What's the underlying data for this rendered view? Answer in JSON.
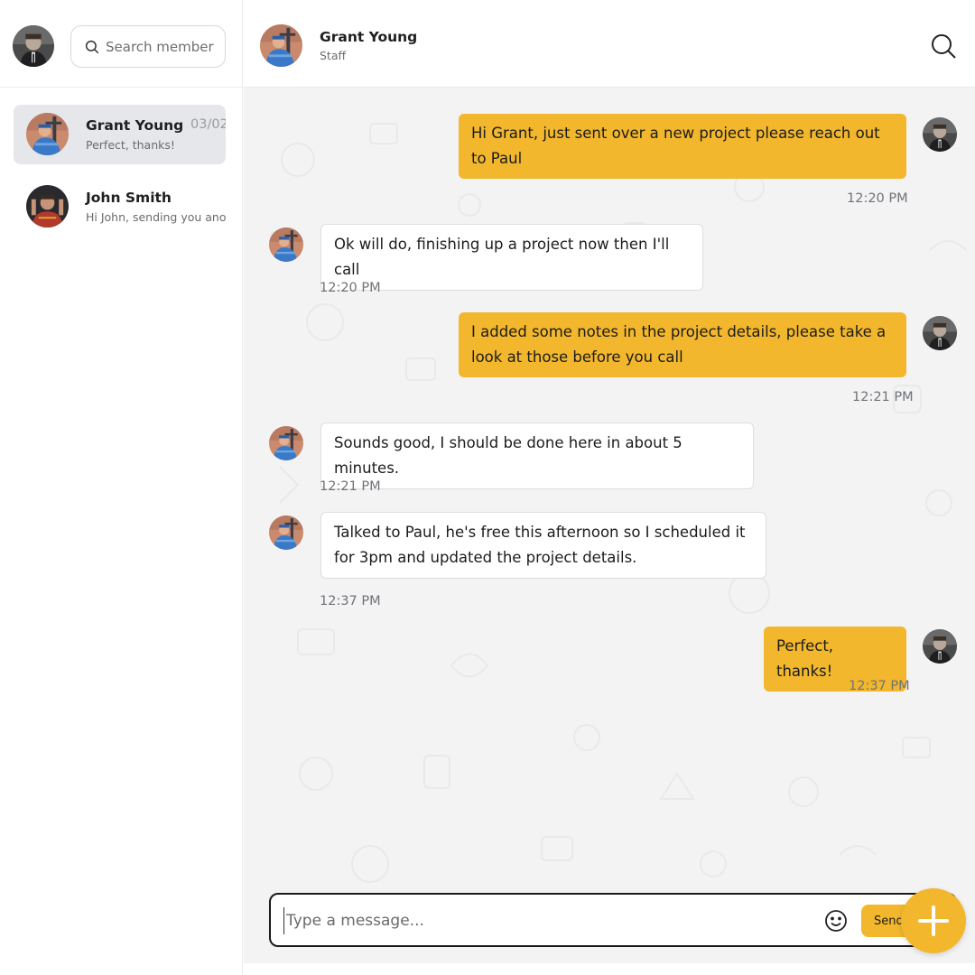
{
  "sidebar": {
    "search_placeholder": "Search member",
    "conversations": [
      {
        "name": "Grant Young",
        "date": "03/02",
        "preview": "Perfect, thanks!"
      },
      {
        "name": "John Smith",
        "date": "",
        "preview": "Hi John, sending you another"
      }
    ]
  },
  "header": {
    "name": "Grant Young",
    "role": "Staff"
  },
  "messages": [
    {
      "direction": "out",
      "text": "Hi Grant, just sent over a new project please reach out to Paul",
      "time": "12:20 PM"
    },
    {
      "direction": "in",
      "text": "Ok will do, finishing up a project now then I'll call",
      "time": "12:20 PM"
    },
    {
      "direction": "out",
      "text": "I added some notes in the project details, please take a look at those before you call",
      "time": "12:21 PM"
    },
    {
      "direction": "in",
      "text": "Sounds good, I should be done here in about 5 minutes.",
      "time": "12:21 PM"
    },
    {
      "direction": "in",
      "text": "Talked to Paul, he's free this afternoon so I scheduled it for 3pm and updated the project details.",
      "time": "12:37 PM"
    },
    {
      "direction": "out",
      "text": "Perfect, thanks!",
      "time": "12:37 PM"
    }
  ],
  "composer": {
    "placeholder": "Type a message...",
    "send_label": "Send"
  },
  "colors": {
    "accent": "#f2b72c",
    "chat_background": "#f3f3f4",
    "incoming_bubble": "#ffffff"
  },
  "icons": {
    "header_search": "search-icon",
    "sidebar_search": "search-icon",
    "emoji": "smiley-icon",
    "fab": "plus-icon"
  }
}
